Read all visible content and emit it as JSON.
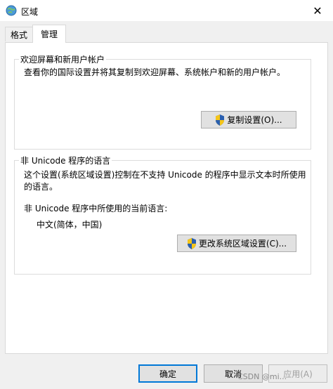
{
  "window": {
    "title": "区域",
    "close_glyph": "✕",
    "app_icon": "globe-icon"
  },
  "tabs": [
    {
      "label": "格式",
      "active": false
    },
    {
      "label": "管理",
      "active": true
    }
  ],
  "welcome_group": {
    "legend": "欢迎屏幕和新用户帐户",
    "description": "查看你的国际设置并将其复制到欢迎屏幕、系统帐户和新的用户帐户。",
    "copy_button": "复制设置(O)...",
    "button_icon": "uac-shield-icon"
  },
  "nonunicode_group": {
    "legend": "非 Unicode 程序的语言",
    "description_line1": "这个设置(系统区域设置)控制在不支持 Unicode 的程序中显示文本时所使用",
    "description_line2": "的语言。",
    "current_label": "非 Unicode 程序中所使用的当前语言:",
    "current_value": "中文(简体，中国)",
    "change_button": "更改系统区域设置(C)...",
    "button_icon": "uac-shield-icon"
  },
  "footer": {
    "ok": "确定",
    "cancel": "取消",
    "apply": "应用(A)"
  },
  "watermark": "CSDN @mi...",
  "colors": {
    "window_bg": "#f0f0f0",
    "panel_bg": "#ffffff",
    "focus_border": "#0078d7"
  }
}
